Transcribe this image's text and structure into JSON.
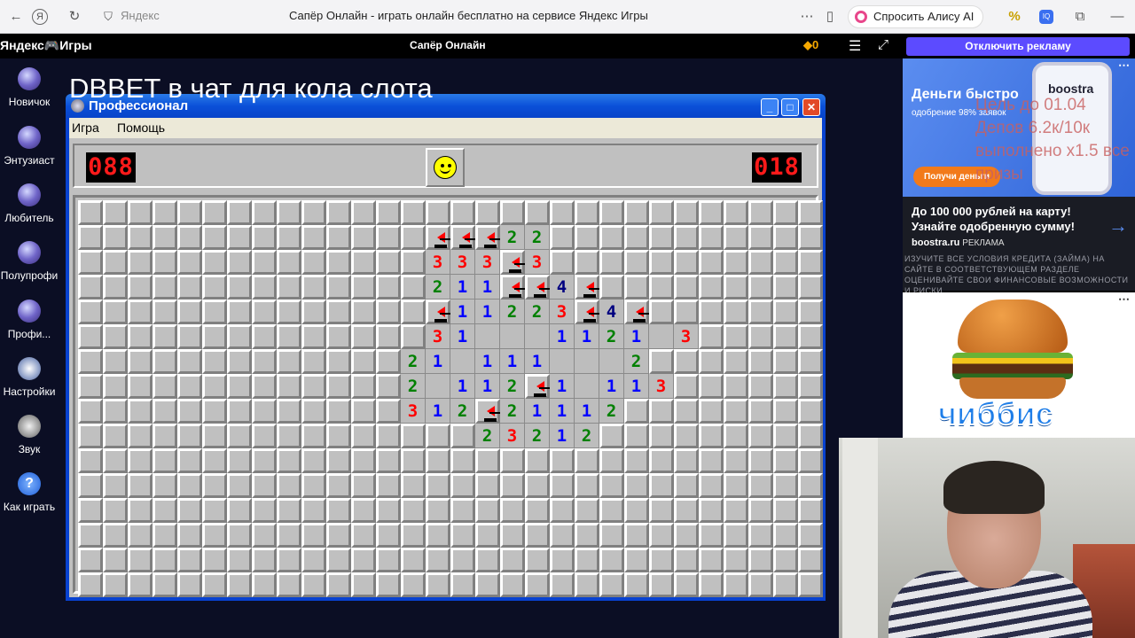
{
  "browser": {
    "address_label": "Яндекс",
    "page_title": "Сапёр Онлайн - играть онлайн бесплатно на сервисе Яндекс Игры",
    "alice_button": "Спросить Алису AI"
  },
  "yg_header": {
    "logo": "Яндекс🎮Игры",
    "game_title": "Сапёр Онлайн",
    "coins": "0",
    "disable_ads": "Отключить рекламу"
  },
  "stream_overlay": "DBBET в чат для кола слота",
  "desktop_icons": [
    {
      "label": "Новичок"
    },
    {
      "label": "Энтузиаст"
    },
    {
      "label": "Любитель"
    },
    {
      "label": "Полупрофи"
    },
    {
      "label": "Профи..."
    },
    {
      "label": "Настройки"
    },
    {
      "label": "Звук"
    },
    {
      "label": "Как играть"
    }
  ],
  "minesweeper": {
    "title": "Профессионал",
    "menu": {
      "game": "Игра",
      "help": "Помощь"
    },
    "mines_counter": "088",
    "timer": "018",
    "grid_cols": 30,
    "grid_rows": 16,
    "cells": [
      "..............................",
      "..............FFF22...........",
      "..............333F3...........",
      "..............211FF4F.........",
      "..............F11223F4F.......",
      "..............31___1121 3.....",
      ".............21_111___2.......",
      ".............2_112F1_113......",
      ".............312F21112........",
      "................23212.........",
      "..............................",
      "..............................",
      "..............................",
      "..............................",
      "..............................",
      ".............................."
    ]
  },
  "ads": {
    "top_headline": "Деньги быстро",
    "top_subline": "одобрение 98% заявок",
    "top_brand": "boostra",
    "get_money_button": "Получи деньги",
    "stream_note": "Цель до 01.04 Депов 6.2к/10к выполнено х1.5 все призы",
    "text_headline": "До 100 000 рублей на карту! Узнайте одобренную сумму!",
    "domain": "boostra.ru",
    "domain_tag": "РЕКЛАМА",
    "disclaimer": "ИЗУЧИТЕ ВСЕ УСЛОВИЯ КРЕДИТА (ЗАЙМА) НА САЙТЕ В СООТВЕТСТВУЮЩЕМ РАЗДЕЛЕ ОЦЕНИВАЙТЕ СВОИ ФИНАНСОВЫЕ ВОЗМОЖНОСТИ И РИСКИ",
    "bottom_brand": "чиббис"
  },
  "icons": {
    "back": "back-arrow-icon",
    "yandex": "yandex-logo-icon",
    "refresh": "refresh-icon",
    "shield": "shield-icon",
    "more": "more-dots-icon",
    "bookmark": "bookmark-icon"
  }
}
